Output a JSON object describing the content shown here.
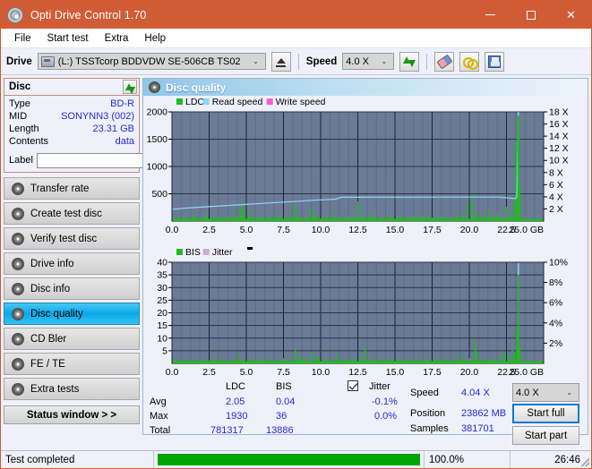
{
  "window": {
    "title": "Opti Drive Control 1.70",
    "icon": "disc-icon",
    "minimize": "–",
    "maximize": "□",
    "close": "✕"
  },
  "menu": {
    "items": [
      "File",
      "Start test",
      "Extra",
      "Help"
    ]
  },
  "toolbar": {
    "drive_label": "Drive",
    "drive_value": "(L:)  TSSTcorp BDDVDW SE-506CB TS02",
    "eject_icon": "eject-icon",
    "speed_label": "Speed",
    "speed_value": "4.0 X",
    "refresh_icon": "refresh-arrows-icon",
    "erase_icon": "eraser-icon",
    "chain_icon": "chain-links-icon",
    "save_icon": "floppy-save-icon"
  },
  "sidebar": {
    "disc_panel": {
      "title": "Disc",
      "refresh_icon": "refresh-arrows-icon",
      "rows": [
        {
          "key": "Type",
          "value": "BD-R"
        },
        {
          "key": "MID",
          "value": "SONYNN3 (002)"
        },
        {
          "key": "Length",
          "value": "23.31 GB"
        },
        {
          "key": "Contents",
          "value": "data"
        }
      ],
      "label_caption": "Label",
      "label_value": "",
      "label_placeholder": "",
      "disc_button_icon": "disc-icon"
    },
    "nav": [
      {
        "label": "Transfer rate",
        "active": false
      },
      {
        "label": "Create test disc",
        "active": false
      },
      {
        "label": "Verify test disc",
        "active": false
      },
      {
        "label": "Drive info",
        "active": false
      },
      {
        "label": "Disc info",
        "active": false
      },
      {
        "label": "Disc quality",
        "active": true
      },
      {
        "label": "CD Bler",
        "active": false
      },
      {
        "label": "FE / TE",
        "active": false
      },
      {
        "label": "Extra tests",
        "active": false
      }
    ],
    "status_window_button": "Status window > >"
  },
  "main": {
    "title": "Disc quality",
    "title_icon": "disc-quality-icon"
  },
  "stats": {
    "col_headers": [
      "LDC",
      "BIS"
    ],
    "jitter_label": "Jitter",
    "jitter_checked": true,
    "rows": [
      {
        "name": "Avg",
        "ldc": "2.05",
        "bis": "0.04",
        "jitter": "-0.1%"
      },
      {
        "name": "Max",
        "ldc": "1930",
        "bis": "36",
        "jitter": "0.0%"
      },
      {
        "name": "Total",
        "ldc": "781317",
        "bis": "13886",
        "jitter": ""
      }
    ],
    "speed_label": "Speed",
    "speed_value": "4.04 X",
    "position_label": "Position",
    "position_value": "23862 MB",
    "samples_label": "Samples",
    "samples_value": "381701",
    "speed_select": "4.0 X",
    "start_full": "Start full",
    "start_part": "Start part"
  },
  "statusbar": {
    "message": "Test completed",
    "percent": "100.0%",
    "elapsed": "26:46",
    "progress": 100
  },
  "colors": {
    "titlebar": "#d05c36",
    "plot_bg": "#6b7a96",
    "ldc_green": "#1fbc1f",
    "read_speed": "#8ed8f8",
    "write_speed": "#ff5ad0",
    "bis_green": "#1fbc1f",
    "jitter_pink": "#d2a8d2",
    "value_blue": "#2a2ad0",
    "progress_green": "#00a400",
    "accent_blue": "#0aa8e8"
  },
  "chart_data": [
    {
      "type": "area",
      "id": "disc-quality-ldc",
      "title": "",
      "xlabel": "GB",
      "ylabel": "",
      "legend": [
        {
          "name": "LDC",
          "color": "#1fbc1f"
        },
        {
          "name": "Read speed",
          "color": "#8ed8f8"
        },
        {
          "name": "Write speed",
          "color": "#ff5ad0"
        }
      ],
      "legend_position": "top-left",
      "grid": true,
      "xlim": [
        0,
        25
      ],
      "xticks": [
        "0.0",
        "2.5",
        "5.0",
        "7.5",
        "10.0",
        "12.5",
        "15.0",
        "17.5",
        "20.0",
        "22.5",
        "25.0 GB"
      ],
      "ylim": [
        0,
        2000
      ],
      "yticks": [
        "500",
        "1000",
        "1500",
        "2000"
      ],
      "y2lim": [
        0,
        18
      ],
      "y2ticks": [
        "2 X",
        "4 X",
        "6 X",
        "8 X",
        "10 X",
        "12 X",
        "14 X",
        "16 X",
        "18 X"
      ],
      "series": [
        {
          "name": "LDC",
          "color": "#1fbc1f",
          "x": [
            0.1,
            0.4,
            0.8,
            1.1,
            1.4,
            1.7,
            2.0,
            2.3,
            2.6,
            2.9,
            3.2,
            3.5,
            3.8,
            4.1,
            4.4,
            4.6,
            4.75,
            4.9,
            5.2,
            5.5,
            5.8,
            6.1,
            6.4,
            6.7,
            7.0,
            7.3,
            7.6,
            7.9,
            8.2,
            8.45,
            8.7,
            9.0,
            9.3,
            9.55,
            9.8,
            10.1,
            10.4,
            10.7,
            11.0,
            11.3,
            11.6,
            11.9,
            12.2,
            12.5,
            12.8,
            13.05,
            13.3,
            13.6,
            13.9,
            14.2,
            14.5,
            14.8,
            15.1,
            15.4,
            15.7,
            16.0,
            16.3,
            16.6,
            16.9,
            17.2,
            17.5,
            17.8,
            18.1,
            18.4,
            18.7,
            19.0,
            19.3,
            19.6,
            19.9,
            20.2,
            20.45,
            20.7,
            21.0,
            21.3,
            21.6,
            21.9,
            22.2,
            22.5,
            22.8,
            23.0,
            23.15,
            23.3,
            23.4
          ],
          "y": [
            55,
            60,
            70,
            58,
            120,
            62,
            95,
            150,
            80,
            70,
            110,
            65,
            75,
            180,
            95,
            330,
            250,
            90,
            200,
            70,
            85,
            60,
            90,
            75,
            160,
            70,
            95,
            65,
            300,
            140,
            80,
            70,
            250,
            160,
            90,
            75,
            110,
            70,
            170,
            60,
            95,
            80,
            70,
            360,
            120,
            75,
            90,
            150,
            70,
            60,
            110,
            85,
            70,
            95,
            60,
            80,
            120,
            70,
            90,
            130,
            60,
            75,
            100,
            85,
            60,
            95,
            140,
            70,
            320,
            480,
            160,
            90,
            120,
            200,
            110,
            140,
            90,
            260,
            130,
            400,
            1450,
            1930,
            600
          ]
        },
        {
          "name": "Read speed",
          "color": "#8ed8f8",
          "x": [
            0.05,
            1.0,
            2.0,
            3.0,
            4.0,
            5.0,
            6.0,
            7.0,
            8.0,
            9.0,
            10.0,
            11.0,
            11.4,
            13.0,
            16.0,
            19.0,
            22.0,
            23.1,
            23.2,
            23.25,
            23.3
          ],
          "y": [
            1.95,
            2.15,
            2.3,
            2.45,
            2.6,
            2.75,
            2.9,
            3.05,
            3.2,
            3.35,
            3.5,
            3.62,
            3.92,
            3.93,
            3.94,
            3.95,
            3.96,
            3.7,
            4.0,
            12.0,
            18.0
          ]
        }
      ]
    },
    {
      "type": "area",
      "id": "disc-quality-bis",
      "title": "",
      "xlabel": "GB",
      "ylabel": "",
      "legend": [
        {
          "name": "BIS",
          "color": "#1fbc1f"
        },
        {
          "name": "Jitter",
          "color": "#d2a8d2"
        }
      ],
      "legend_position": "top-left",
      "grid": true,
      "xlim": [
        0,
        25
      ],
      "xticks": [
        "0.0",
        "2.5",
        "5.0",
        "7.5",
        "10.0",
        "12.5",
        "15.0",
        "17.5",
        "20.0",
        "22.5",
        "25.0 GB"
      ],
      "ylim": [
        0,
        40
      ],
      "yticks": [
        "5",
        "10",
        "15",
        "20",
        "25",
        "30",
        "35",
        "40"
      ],
      "y2lim": [
        0,
        10
      ],
      "y2ticks": [
        "2%",
        "4%",
        "6%",
        "8%",
        "10%"
      ],
      "series": [
        {
          "name": "BIS",
          "color": "#1fbc1f",
          "x": [
            0.1,
            0.5,
            0.9,
            1.3,
            1.7,
            2.1,
            2.5,
            2.9,
            3.3,
            3.7,
            4.1,
            4.5,
            4.8,
            5.1,
            5.5,
            5.9,
            6.3,
            6.7,
            7.1,
            7.5,
            7.9,
            8.3,
            8.6,
            8.8,
            9.0,
            9.4,
            9.7,
            9.9,
            10.3,
            10.7,
            11.1,
            11.5,
            11.8,
            12.2,
            12.6,
            13.0,
            13.2,
            13.6,
            14.0,
            14.4,
            14.8,
            15.2,
            15.6,
            16.0,
            16.4,
            16.8,
            17.2,
            17.6,
            18.0,
            18.4,
            18.8,
            19.2,
            19.6,
            20.0,
            20.4,
            20.5,
            20.9,
            21.3,
            21.7,
            22.1,
            22.4,
            22.7,
            22.9,
            23.05,
            23.2,
            23.3,
            23.4
          ],
          "y": [
            1.2,
            1.5,
            1.1,
            2.0,
            1.4,
            1.8,
            1.2,
            2.6,
            1.5,
            1.3,
            2.1,
            3.5,
            1.6,
            1.4,
            2.2,
            1.3,
            2.8,
            1.5,
            1.2,
            2.0,
            1.6,
            5.2,
            3.0,
            2.4,
            1.8,
            4.2,
            2.2,
            3.0,
            1.7,
            2.1,
            4.0,
            1.5,
            2.3,
            1.8,
            2.5,
            6.8,
            2.2,
            1.6,
            3.0,
            2.0,
            1.5,
            2.6,
            1.8,
            2.2,
            1.4,
            2.9,
            1.7,
            2.2,
            1.5,
            2.0,
            1.6,
            2.4,
            3.0,
            2.1,
            9.6,
            4.2,
            2.0,
            2.6,
            1.8,
            3.4,
            4.0,
            2.8,
            5.2,
            3.6,
            14.8,
            35.0,
            6.0
          ]
        },
        {
          "name": "Jitter",
          "color": "#d2a8d2",
          "x": [],
          "y": []
        }
      ]
    }
  ]
}
